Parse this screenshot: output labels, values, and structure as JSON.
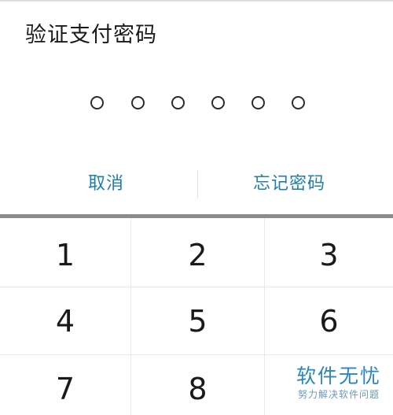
{
  "dialog": {
    "title": "验证支付密码",
    "pin_length": 6
  },
  "actions": {
    "cancel_label": "取消",
    "forgot_label": "忘记密码"
  },
  "keypad": {
    "keys": [
      "1",
      "2",
      "3",
      "4",
      "5",
      "6",
      "7",
      "8"
    ]
  },
  "watermark": {
    "main": "软件无忧",
    "sub": "努力解决软件问题"
  },
  "colors": {
    "accent": "#1e7fa8",
    "watermark": "#2a86c0",
    "keyboard_bar": "#8c8c8c"
  }
}
